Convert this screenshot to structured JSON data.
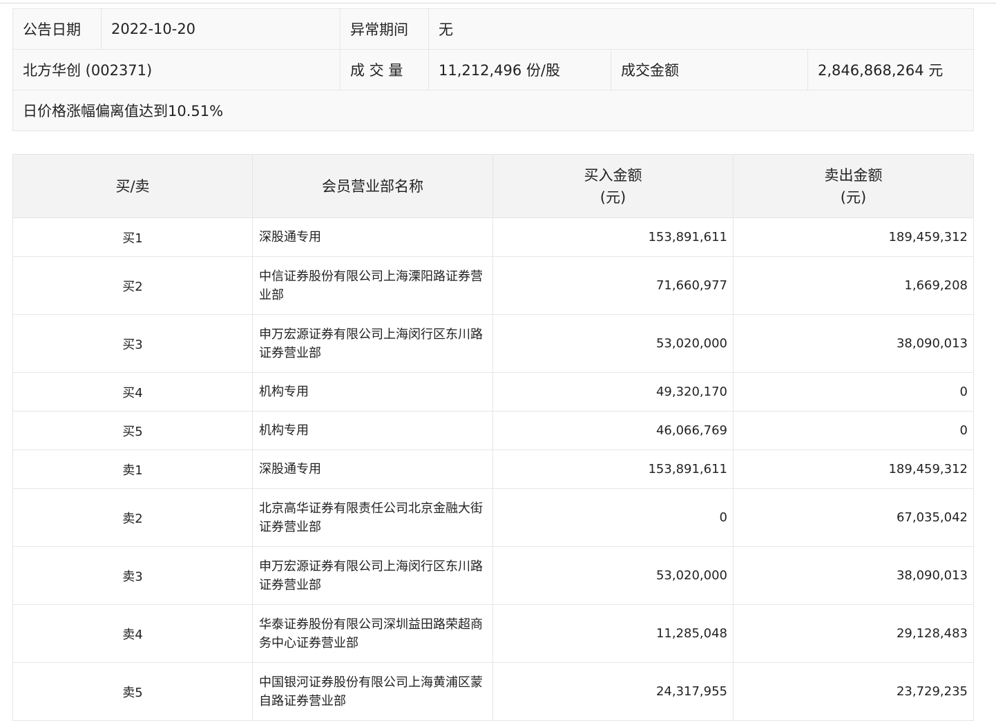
{
  "summary": {
    "date_label": "公告日期",
    "date_value": "2022-10-20",
    "abnormal_label": "异常期间",
    "abnormal_value": "无",
    "stock": "北方华创 (002371)",
    "volume_label": "成 交 量",
    "volume_value": "11,212,496 份/股",
    "amount_label": "成交金额",
    "amount_value": "2,846,868,264 元",
    "reason": "日价格涨幅偏离值达到10.51%"
  },
  "table": {
    "headers": {
      "side": "买/卖",
      "name": "会员营业部名称",
      "buy_line1": "买入金额",
      "buy_line2": "(元)",
      "sell_line1": "卖出金额",
      "sell_line2": "(元)"
    },
    "rows": [
      {
        "side": "买1",
        "name": "深股通专用",
        "buy": "153,891,611",
        "sell": "189,459,312"
      },
      {
        "side": "买2",
        "name": "中信证券股份有限公司上海溧阳路证券营业部",
        "buy": "71,660,977",
        "sell": "1,669,208"
      },
      {
        "side": "买3",
        "name": "申万宏源证券有限公司上海闵行区东川路证券营业部",
        "buy": "53,020,000",
        "sell": "38,090,013"
      },
      {
        "side": "买4",
        "name": "机构专用",
        "buy": "49,320,170",
        "sell": "0"
      },
      {
        "side": "买5",
        "name": "机构专用",
        "buy": "46,066,769",
        "sell": "0"
      },
      {
        "side": "卖1",
        "name": "深股通专用",
        "buy": "153,891,611",
        "sell": "189,459,312"
      },
      {
        "side": "卖2",
        "name": "北京高华证券有限责任公司北京金融大街证券营业部",
        "buy": "0",
        "sell": "67,035,042"
      },
      {
        "side": "卖3",
        "name": "申万宏源证券有限公司上海闵行区东川路证券营业部",
        "buy": "53,020,000",
        "sell": "38,090,013"
      },
      {
        "side": "卖4",
        "name": "华泰证券股份有限公司深圳益田路荣超商务中心证券营业部",
        "buy": "11,285,048",
        "sell": "29,128,483"
      },
      {
        "side": "卖5",
        "name": "中国银河证券股份有限公司上海黄浦区蒙自路证券营业部",
        "buy": "24,317,955",
        "sell": "23,729,235"
      }
    ]
  }
}
